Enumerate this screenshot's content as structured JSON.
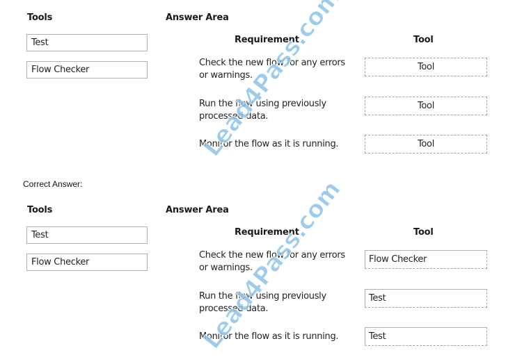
{
  "question": {
    "tools_heading": "Tools",
    "answer_area_heading": "Answer Area",
    "requirement_heading": "Requirement",
    "tool_heading": "Tool",
    "tools": [
      {
        "label": "Test"
      },
      {
        "label": "Flow Checker"
      }
    ],
    "requirements": [
      {
        "text": "Check the new flow for any errors or warnings.",
        "slot": "Tool"
      },
      {
        "text": "Run the flow using previously processed data.",
        "slot": "Tool"
      },
      {
        "text": "Monitor the flow as it is running.",
        "slot": "Tool"
      }
    ]
  },
  "correct_answer_label": "Correct Answer:",
  "answer": {
    "tools_heading": "Tools",
    "answer_area_heading": "Answer Area",
    "requirement_heading": "Requirement",
    "tool_heading": "Tool",
    "tools": [
      {
        "label": "Test"
      },
      {
        "label": "Flow Checker"
      }
    ],
    "requirements": [
      {
        "text": "Check the new flow for any errors or warnings.",
        "slot": "Flow Checker"
      },
      {
        "text": "Run the flow using previously processed data.",
        "slot": "Test"
      },
      {
        "text": "Monitor the flow as it is running.",
        "slot": "Test"
      }
    ]
  },
  "watermark": {
    "text": "Lead4Pass.com",
    "color": "#8cc3e6"
  }
}
